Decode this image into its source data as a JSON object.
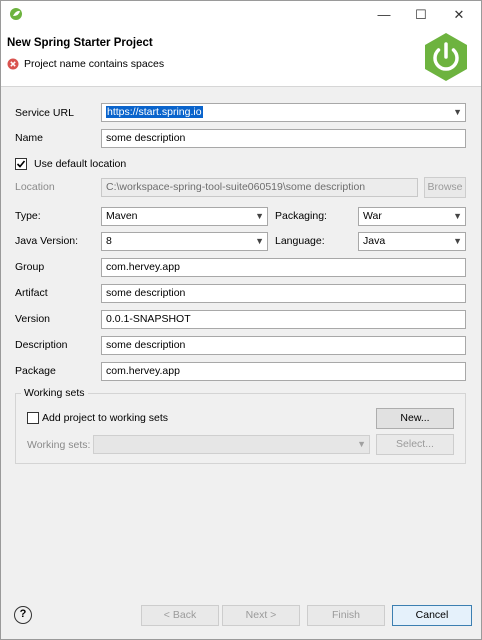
{
  "window": {
    "minimize_glyph": "—",
    "maximize_glyph": "☐",
    "close_glyph": "✕"
  },
  "header": {
    "title": "New Spring Starter Project",
    "error_message": "Project name contains spaces",
    "error_icon": "error-icon",
    "logo_icon": "spring-power-icon"
  },
  "form": {
    "service_url_label": "Service URL",
    "service_url_value": "https://start.spring.io",
    "name_label": "Name",
    "name_value": "some description",
    "use_default_location_label": "Use default location",
    "location_label": "Location",
    "location_value": "C:\\workspace-spring-tool-suite060519\\some description",
    "browse_label": "Browse",
    "type_label": "Type:",
    "type_value": "Maven",
    "packaging_label": "Packaging:",
    "packaging_value": "War",
    "java_version_label": "Java Version:",
    "java_version_value": "8",
    "language_label": "Language:",
    "language_value": "Java",
    "group_label": "Group",
    "group_value": "com.hervey.app",
    "artifact_label": "Artifact",
    "artifact_value": "some description",
    "version_label": "Version",
    "version_value": "0.0.1-SNAPSHOT",
    "description_label": "Description",
    "description_value": "some description",
    "package_label": "Package",
    "package_value": "com.hervey.app"
  },
  "working_sets": {
    "group_title": "Working sets",
    "add_label": "Add project to working sets",
    "new_button": "New...",
    "sets_label": "Working sets:",
    "select_button": "Select..."
  },
  "footer": {
    "help_glyph": "?",
    "back_button": "< Back",
    "next_button": "Next >",
    "finish_button": "Finish",
    "cancel_button": "Cancel"
  },
  "colors": {
    "spring_green": "#6db33f",
    "error_red": "#d9534f",
    "selection_blue": "#0a64cc"
  }
}
